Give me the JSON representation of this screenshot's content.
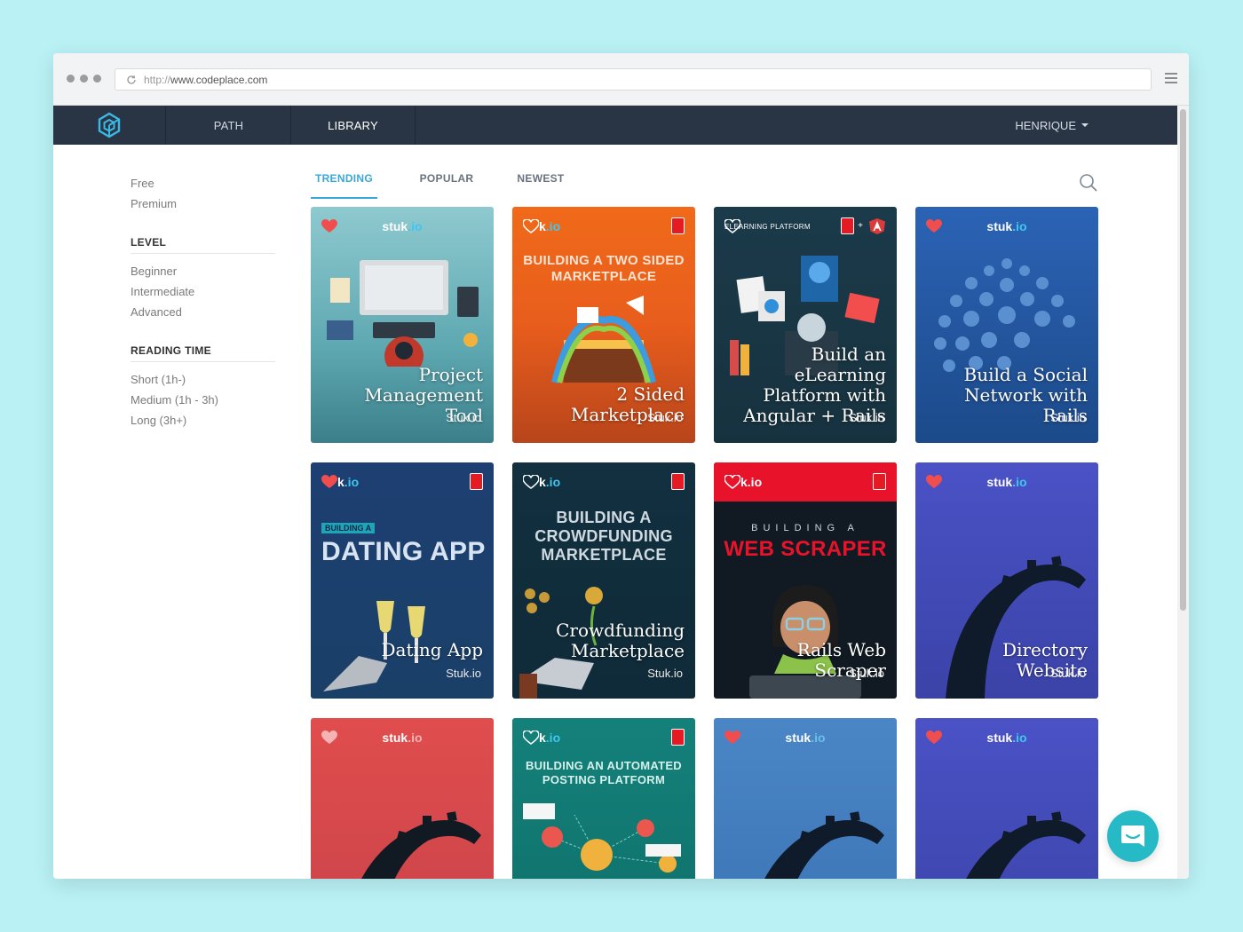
{
  "browser": {
    "url_scheme": "http://",
    "url_host": "www.codeplace.com"
  },
  "nav": {
    "items": [
      {
        "label": "PATH"
      },
      {
        "label": "LIBRARY"
      }
    ],
    "user": "HENRIQUE"
  },
  "sidebar": {
    "plans": [
      "Free",
      "Premium"
    ],
    "level_title": "LEVEL",
    "levels": [
      "Beginner",
      "Intermediate",
      "Advanced"
    ],
    "reading_title": "READING TIME",
    "reading": [
      "Short (1h-)",
      "Medium (1h - 3h)",
      "Long (3h+)"
    ]
  },
  "tabs": [
    "TRENDING",
    "POPULAR",
    "NEWEST"
  ],
  "brand": {
    "name": "stuk",
    "suffix": ".io",
    "left_name": "k",
    "partner": "ELEARNING PLATFORM",
    "plus": "+",
    "building_a": "BUILDING A"
  },
  "cards": [
    {
      "title": "Project Management Tool",
      "title_l1": "Project",
      "title_l2": "Management Tool",
      "author": "Stuk.io"
    },
    {
      "headline_l1": "BUILDING A TWO SIDED",
      "headline_l2": "MARKETPLACE",
      "title": "2 Sided Marketplace",
      "author": "Stuk.io"
    },
    {
      "title_l1": "Build an eLearning",
      "title_l2": "Platform with",
      "title_l3": "Angular + Rails",
      "author": "Stuk.io"
    },
    {
      "title_l1": "Build a Social",
      "title_l2": "Network with Rails",
      "author": "Stuk.io"
    },
    {
      "headline": "DATING APP",
      "title": "Dating App",
      "author": "Stuk.io"
    },
    {
      "headline_l1": "BUILDING A",
      "headline_l2": "CROWDFUNDING",
      "headline_l3": "MARKETPLACE",
      "title_l1": "Crowdfunding",
      "title_l2": "Marketplace",
      "author": "Stuk.io"
    },
    {
      "headline_l1": "BUILDING A",
      "headline_l2": "WEB SCRAPER",
      "title": "Rails Web Scraper",
      "author": "Stuk.io"
    },
    {
      "title": "Directory Website",
      "author": "Stuk.io"
    },
    {},
    {
      "headline_l1": "BUILDING AN AUTOMATED",
      "headline_l2": "POSTING PLATFORM"
    },
    {},
    {}
  ],
  "colors": {
    "nav_bg": "#293544",
    "accent": "#3aa7d9",
    "chat": "#26b9c6",
    "heart": "#f04e4e"
  }
}
